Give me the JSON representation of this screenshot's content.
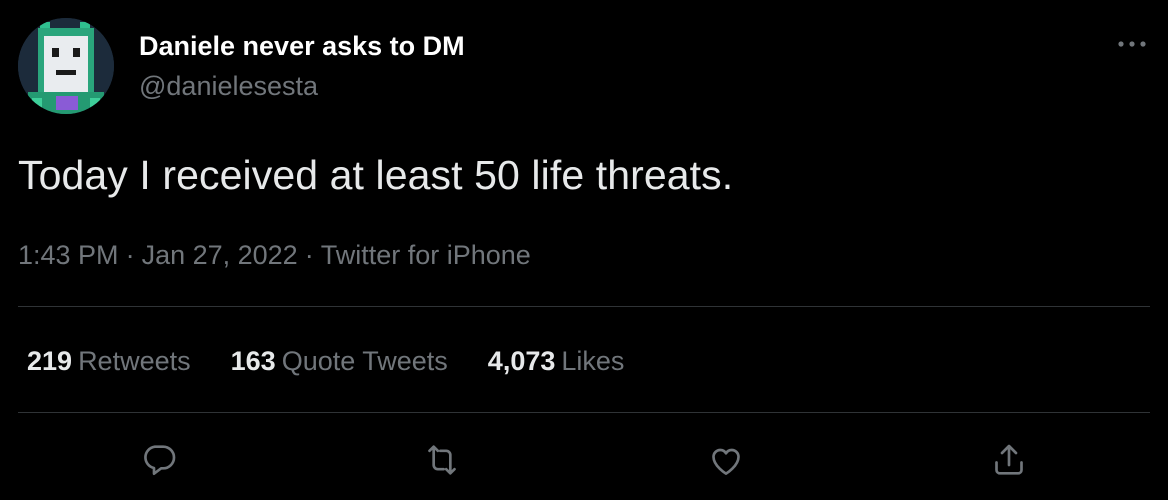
{
  "tweet": {
    "author": {
      "display_name": "Daniele never asks to DM",
      "handle": "@danielesesta"
    },
    "text": "Today I received at least 50 life threats.",
    "meta": {
      "time": "1:43 PM",
      "separator": "·",
      "date": "Jan 27, 2022",
      "source": "Twitter for iPhone"
    },
    "stats": [
      {
        "count": "219",
        "label": "Retweets"
      },
      {
        "count": "163",
        "label": "Quote Tweets"
      },
      {
        "count": "4,073",
        "label": "Likes"
      }
    ],
    "actions": [
      "reply-icon",
      "retweet-icon",
      "like-icon",
      "share-icon"
    ],
    "more_icon": "more-horizontal-icon"
  },
  "colors": {
    "background": "#000000",
    "primary_text": "#e7e9ea",
    "secondary_text": "#71767b",
    "divider": "#2f3336"
  }
}
